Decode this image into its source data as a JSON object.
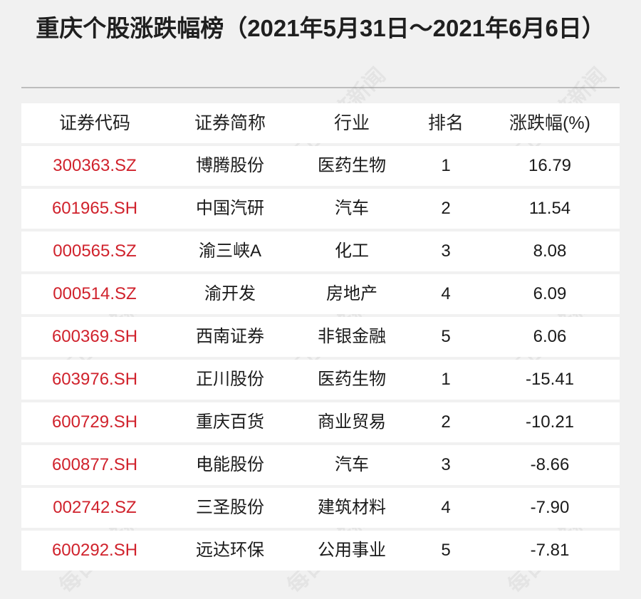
{
  "title": "重庆个股涨跌幅榜（2021年5月31日～2021年6月6日）",
  "watermark": "每日经济新闻",
  "table": {
    "headers": [
      "证券代码",
      "证券简称",
      "行业",
      "排名",
      "涨跌幅(%)"
    ],
    "rows": [
      {
        "code": "300363.SZ",
        "name": "博腾股份",
        "industry": "医药生物",
        "rank": "1",
        "change": "16.79"
      },
      {
        "code": "601965.SH",
        "name": "中国汽研",
        "industry": "汽车",
        "rank": "2",
        "change": "11.54"
      },
      {
        "code": "000565.SZ",
        "name": "渝三峡A",
        "industry": "化工",
        "rank": "3",
        "change": "8.08"
      },
      {
        "code": "000514.SZ",
        "name": "渝开发",
        "industry": "房地产",
        "rank": "4",
        "change": "6.09"
      },
      {
        "code": "600369.SH",
        "name": "西南证券",
        "industry": "非银金融",
        "rank": "5",
        "change": "6.06"
      },
      {
        "code": "603976.SH",
        "name": "正川股份",
        "industry": "医药生物",
        "rank": "1",
        "change": "-15.41"
      },
      {
        "code": "600729.SH",
        "name": "重庆百货",
        "industry": "商业贸易",
        "rank": "2",
        "change": "-10.21"
      },
      {
        "code": "600877.SH",
        "name": "电能股份",
        "industry": "汽车",
        "rank": "3",
        "change": "-8.66"
      },
      {
        "code": "002742.SZ",
        "name": "三圣股份",
        "industry": "建筑材料",
        "rank": "4",
        "change": "-7.90"
      },
      {
        "code": "600292.SH",
        "name": "远达环保",
        "industry": "公用事业",
        "rank": "5",
        "change": "-7.81"
      }
    ]
  },
  "colors": {
    "code_red": "#d0222c",
    "background": "#f1f1f1",
    "row_bg": "#ffffff"
  }
}
